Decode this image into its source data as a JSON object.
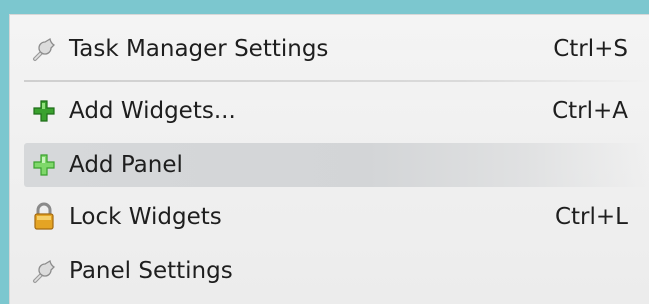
{
  "menu": {
    "items": [
      {
        "label": "Task Manager Settings",
        "shortcut": "Ctrl+S",
        "icon": "wrench-icon"
      },
      {
        "label": "Add Widgets...",
        "shortcut": "Ctrl+A",
        "icon": "plus-icon"
      },
      {
        "label": "Add Panel",
        "shortcut": "",
        "icon": "plus-icon"
      },
      {
        "label": "Lock Widgets",
        "shortcut": "Ctrl+L",
        "icon": "lock-icon"
      },
      {
        "label": "Panel Settings",
        "shortcut": "",
        "icon": "wrench-icon"
      }
    ]
  },
  "colors": {
    "background": "#7cc7cf",
    "menu": "#f0f0f0",
    "highlight": "#d4d6d8",
    "plus_green": "#3aa12e",
    "plus_light_green": "#7fd86a",
    "lock_gold": "#e0a020"
  }
}
